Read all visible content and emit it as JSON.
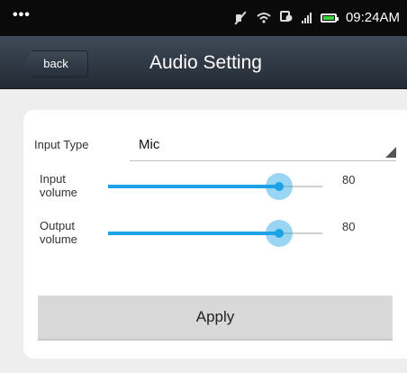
{
  "status_bar": {
    "dots": "•••",
    "time": "09:24AM",
    "icons": [
      "mute-icon",
      "wifi-icon",
      "sync-icon",
      "signal-icon",
      "battery-icon"
    ],
    "battery_color": "#3cd23c"
  },
  "header": {
    "back_label": "back",
    "title": "Audio Setting"
  },
  "form": {
    "input_type": {
      "label": "Input Type",
      "value": "Mic"
    },
    "input_volume": {
      "label_line1": "Input",
      "label_line2": "volume",
      "value": "80",
      "level_percent": 80
    },
    "output_volume": {
      "label_line1": "Output",
      "label_line2": "volume",
      "value": "80",
      "level_percent": 80
    },
    "apply_label": "Apply"
  },
  "colors": {
    "accent": "#1ea2e6",
    "header_top": "#3e4a58",
    "header_bottom": "#232b35",
    "button_bg": "#d8d8d8"
  }
}
